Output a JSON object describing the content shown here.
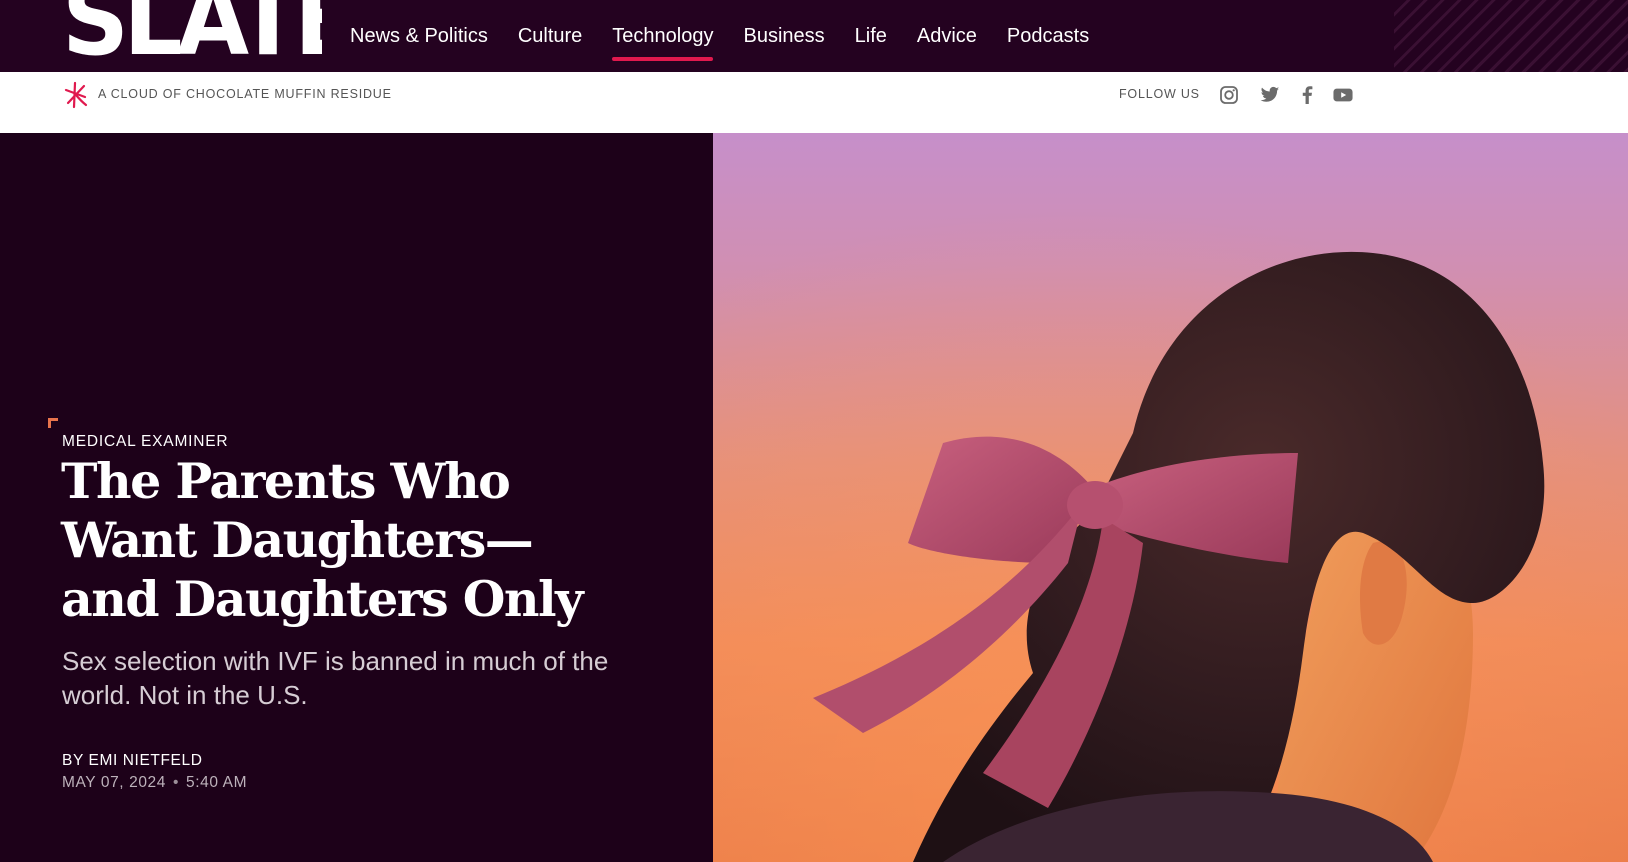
{
  "brand": {
    "logo_text": "SLATE",
    "tagline": "A CLOUD OF CHOCOLATE MUFFIN RESIDUE"
  },
  "nav": {
    "items": [
      {
        "label": "News & Politics",
        "active": false
      },
      {
        "label": "Culture",
        "active": false
      },
      {
        "label": "Technology",
        "active": true
      },
      {
        "label": "Business",
        "active": false
      },
      {
        "label": "Life",
        "active": false
      },
      {
        "label": "Advice",
        "active": false
      },
      {
        "label": "Podcasts",
        "active": false
      }
    ],
    "accent_color": "#e0194e"
  },
  "social": {
    "label": "FOLLOW US",
    "icons": [
      "instagram-icon",
      "twitter-icon",
      "facebook-icon",
      "youtube-icon"
    ]
  },
  "article": {
    "kicker": "MEDICAL EXAMINER",
    "headline_lines": [
      "The Parents Who",
      "Want Daughters—",
      "and Daughters Only"
    ],
    "dek": "Sex selection with IVF is banned in much of the world. Not in the U.S.",
    "byline": "BY EMI NIETFELD",
    "date": "MAY 07, 2024",
    "time": "5:40 AM"
  },
  "colors": {
    "header_bg": "#240220",
    "hero_bg": "#1d0119",
    "kicker_mark": "#e8744c"
  }
}
